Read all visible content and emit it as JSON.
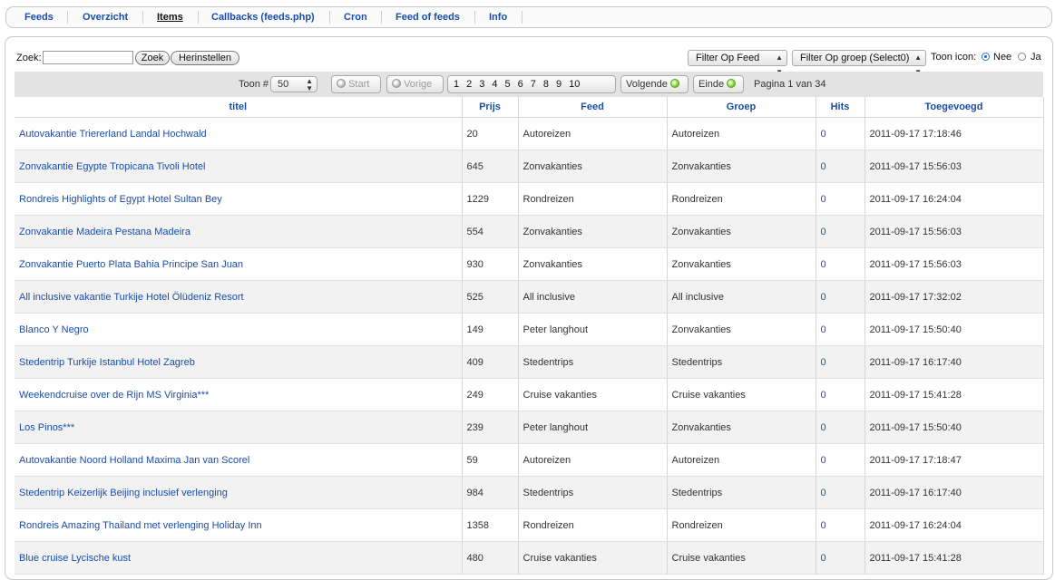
{
  "nav": {
    "tabs": [
      "Feeds",
      "Overzicht",
      "Items",
      "Callbacks (feeds.php)",
      "Cron",
      "Feed of feeds",
      "Info"
    ],
    "active": "Items"
  },
  "search": {
    "label": "Zoek:",
    "value": "",
    "search_button": "Zoek",
    "reset_button": "Herinstellen"
  },
  "filters": {
    "feed": "Filter Op Feed",
    "group": "Filter Op groep (Select0)",
    "toon_icon_label": "Toon icon:",
    "nee": "Nee",
    "ja": "Ja",
    "selected": "Nee"
  },
  "pager": {
    "toon_label": "Toon #",
    "toon_value": "50",
    "start": "Start",
    "vorige": "Vorige",
    "pages": [
      "1",
      "2",
      "3",
      "4",
      "5",
      "6",
      "7",
      "8",
      "9",
      "10"
    ],
    "volgende": "Volgende",
    "einde": "Einde",
    "info": "Pagina 1 van 34"
  },
  "table": {
    "headers": [
      "titel",
      "Prijs",
      "Feed",
      "Groep",
      "Hits",
      "Toegevoegd"
    ],
    "rows": [
      [
        "Autovakantie Triererland Landal Hochwald",
        "20",
        "Autoreizen",
        "Autoreizen",
        "0",
        "2011-09-17 17:18:46"
      ],
      [
        "Zonvakantie Egypte Tropicana Tivoli Hotel",
        "645",
        "Zonvakanties",
        "Zonvakanties",
        "0",
        "2011-09-17 15:56:03"
      ],
      [
        "Rondreis Highlights of Egypt Hotel Sultan Bey",
        "1229",
        "Rondreizen",
        "Rondreizen",
        "0",
        "2011-09-17 16:24:04"
      ],
      [
        "Zonvakantie Madeira Pestana Madeira",
        "554",
        "Zonvakanties",
        "Zonvakanties",
        "0",
        "2011-09-17 15:56:03"
      ],
      [
        "Zonvakantie Puerto Plata Bahia Principe San Juan",
        "930",
        "Zonvakanties",
        "Zonvakanties",
        "0",
        "2011-09-17 15:56:03"
      ],
      [
        "All inclusive vakantie Turkije Hotel Ölüdeniz Resort",
        "525",
        "All inclusive",
        "All inclusive",
        "0",
        "2011-09-17 17:32:02"
      ],
      [
        "Blanco Y Negro",
        "149",
        "Peter langhout",
        "Zonvakanties",
        "0",
        "2011-09-17 15:50:40"
      ],
      [
        "Stedentrip Turkije Istanbul Hotel Zagreb",
        "409",
        "Stedentrips",
        "Stedentrips",
        "0",
        "2011-09-17 16:17:40"
      ],
      [
        "Weekendcruise over de Rijn MS Virginia***",
        "249",
        "Cruise vakanties",
        "Cruise vakanties",
        "0",
        "2011-09-17 15:41:28"
      ],
      [
        "Los Pinos***",
        "239",
        "Peter langhout",
        "Zonvakanties",
        "0",
        "2011-09-17 15:50:40"
      ],
      [
        "Autovakantie Noord Holland Maxima Jan van Scorel",
        "59",
        "Autoreizen",
        "Autoreizen",
        "0",
        "2011-09-17 17:18:47"
      ],
      [
        "Stedentrip Keizerlijk Beijing inclusief verlenging",
        "984",
        "Stedentrips",
        "Stedentrips",
        "0",
        "2011-09-17 16:17:40"
      ],
      [
        "Rondreis Amazing Thailand met verlenging Holiday Inn",
        "1358",
        "Rondreizen",
        "Rondreizen",
        "0",
        "2011-09-17 16:24:04"
      ],
      [
        "Blue cruise Lycische kust",
        "480",
        "Cruise vakanties",
        "Cruise vakanties",
        "0",
        "2011-09-17 15:41:28"
      ]
    ]
  }
}
